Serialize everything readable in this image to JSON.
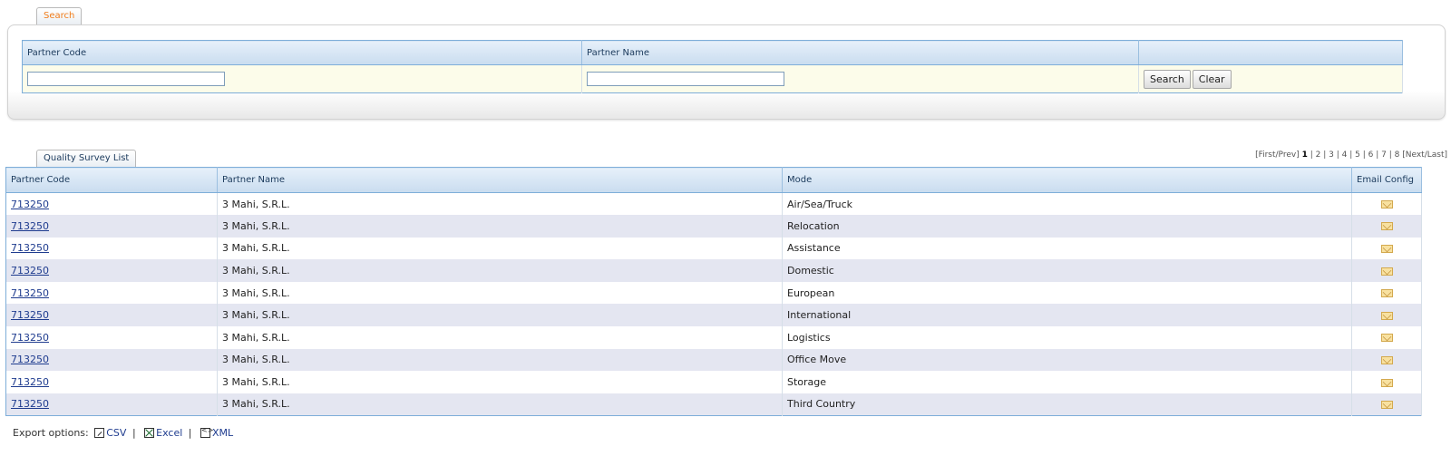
{
  "search": {
    "tab_label": "Search",
    "headers": [
      "Partner Code",
      "Partner Name",
      ""
    ],
    "partner_code_value": "",
    "partner_name_value": "",
    "search_button": "Search",
    "clear_button": "Clear"
  },
  "list": {
    "tab_label": "Quality Survey List",
    "pager": {
      "first_prev": "[First/Prev]",
      "pages": [
        "1",
        "2",
        "3",
        "4",
        "5",
        "6",
        "7",
        "8"
      ],
      "current": "1",
      "next_last": "[Next/Last]"
    },
    "columns": [
      "Partner Code",
      "Partner Name",
      "Mode",
      "Email Config"
    ],
    "rows": [
      {
        "code": "713250",
        "name": "3 Mahi, S.R.L.",
        "mode": "Air/Sea/Truck"
      },
      {
        "code": "713250",
        "name": "3 Mahi, S.R.L.",
        "mode": "Relocation"
      },
      {
        "code": "713250",
        "name": "3 Mahi, S.R.L.",
        "mode": "Assistance"
      },
      {
        "code": "713250",
        "name": "3 Mahi, S.R.L.",
        "mode": "Domestic"
      },
      {
        "code": "713250",
        "name": "3 Mahi, S.R.L.",
        "mode": "European"
      },
      {
        "code": "713250",
        "name": "3 Mahi, S.R.L.",
        "mode": "International"
      },
      {
        "code": "713250",
        "name": "3 Mahi, S.R.L.",
        "mode": "Logistics"
      },
      {
        "code": "713250",
        "name": "3 Mahi, S.R.L.",
        "mode": "Office Move"
      },
      {
        "code": "713250",
        "name": "3 Mahi, S.R.L.",
        "mode": "Storage"
      },
      {
        "code": "713250",
        "name": "3 Mahi, S.R.L.",
        "mode": "Third Country"
      }
    ],
    "row_icon": "envelope-icon"
  },
  "export": {
    "label": "Export options:",
    "csv": "CSV",
    "excel": "Excel",
    "xml": "XML",
    "separator": "|"
  }
}
